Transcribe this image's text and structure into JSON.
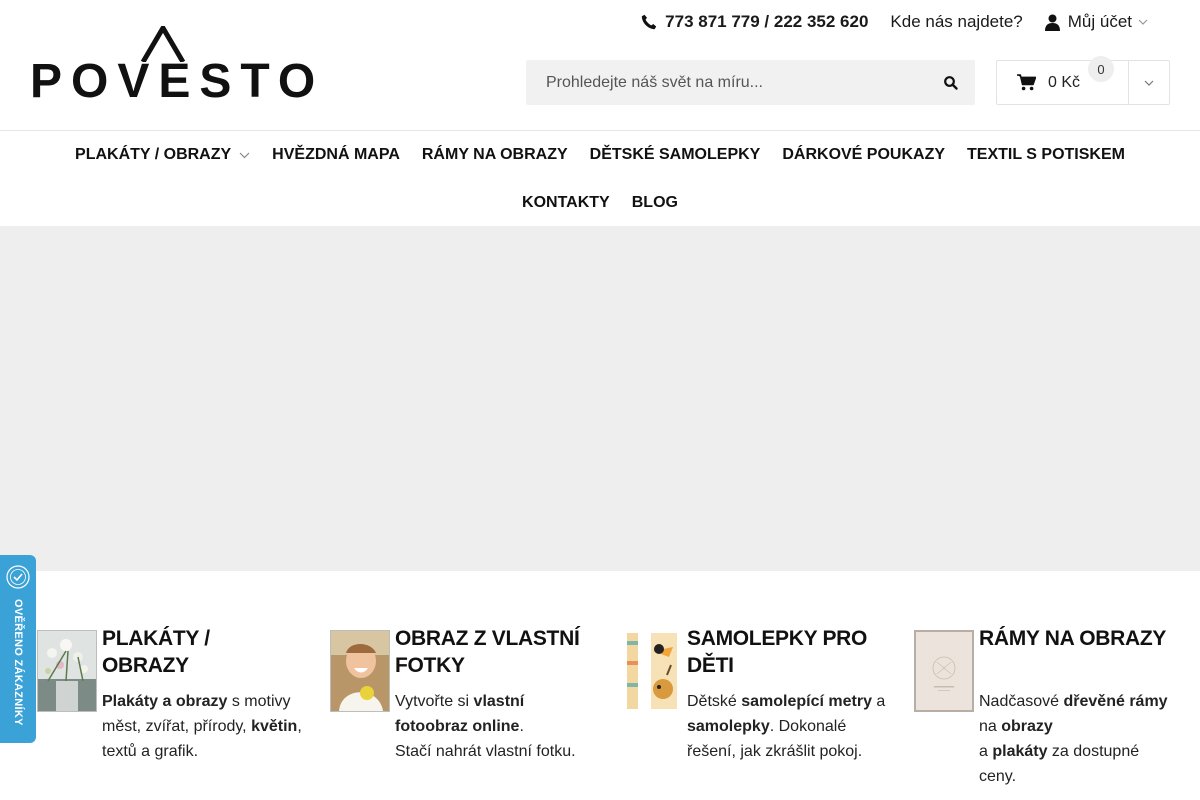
{
  "logo": {
    "text": "POVESTO"
  },
  "topbar": {
    "phone": "773 871 779 / 222 352 620",
    "find_us": "Kde nás najdete?",
    "account": "Můj účet"
  },
  "search": {
    "placeholder": "Prohledejte náš svět na míru..."
  },
  "cart": {
    "price": "0 Kč",
    "count": "0"
  },
  "nav": {
    "items": [
      {
        "label": "PLAKÁTY / OBRAZY"
      },
      {
        "label": "HVĚZDNÁ MAPA"
      },
      {
        "label": "RÁMY NA OBRAZY"
      },
      {
        "label": "DĚTSKÉ SAMOLEPKY"
      },
      {
        "label": "DÁRKOVÉ POUKAZY"
      },
      {
        "label": "TEXTIL S POTISKEM"
      },
      {
        "label": "KONTAKTY"
      },
      {
        "label": "BLOG"
      }
    ]
  },
  "badge": {
    "text": "OVĚŘENO ZÁKAZNÍKY"
  },
  "categories": [
    {
      "title": "PLAKÁTY / OBRAZY",
      "d1": "Plakáty a obrazy",
      "d2": " s motivy měst, zvířat, přírody, ",
      "d3": "květin",
      "d4": ", textů a grafik."
    },
    {
      "title": "OBRAZ Z VLASTNÍ FOTKY",
      "d1": "Vytvořte si ",
      "d2": "vlastní fotoobraz online",
      "d3": ".",
      "d4": "Stačí nahrát vlastní fotku."
    },
    {
      "title": "SAMOLEPKY PRO DĚTI",
      "d1": "Dětské ",
      "d2": "samolepící metry",
      "d3": " a ",
      "d4": "samolepky",
      "d5": ". Dokonalé řešení, jak zkrášlit pokoj."
    },
    {
      "title": "RÁMY NA OBRAZY",
      "d1": "Nadčasové ",
      "d2": "dřevěné rámy",
      "d3": " na ",
      "d4": "obrazy",
      "d5": " a ",
      "d6": "plakáty",
      "d7": " za dostupné ceny."
    }
  ],
  "colors": {
    "badge": "#3ba2d8",
    "hero": "#eeeeee",
    "search_bg": "#f1f1f1"
  }
}
